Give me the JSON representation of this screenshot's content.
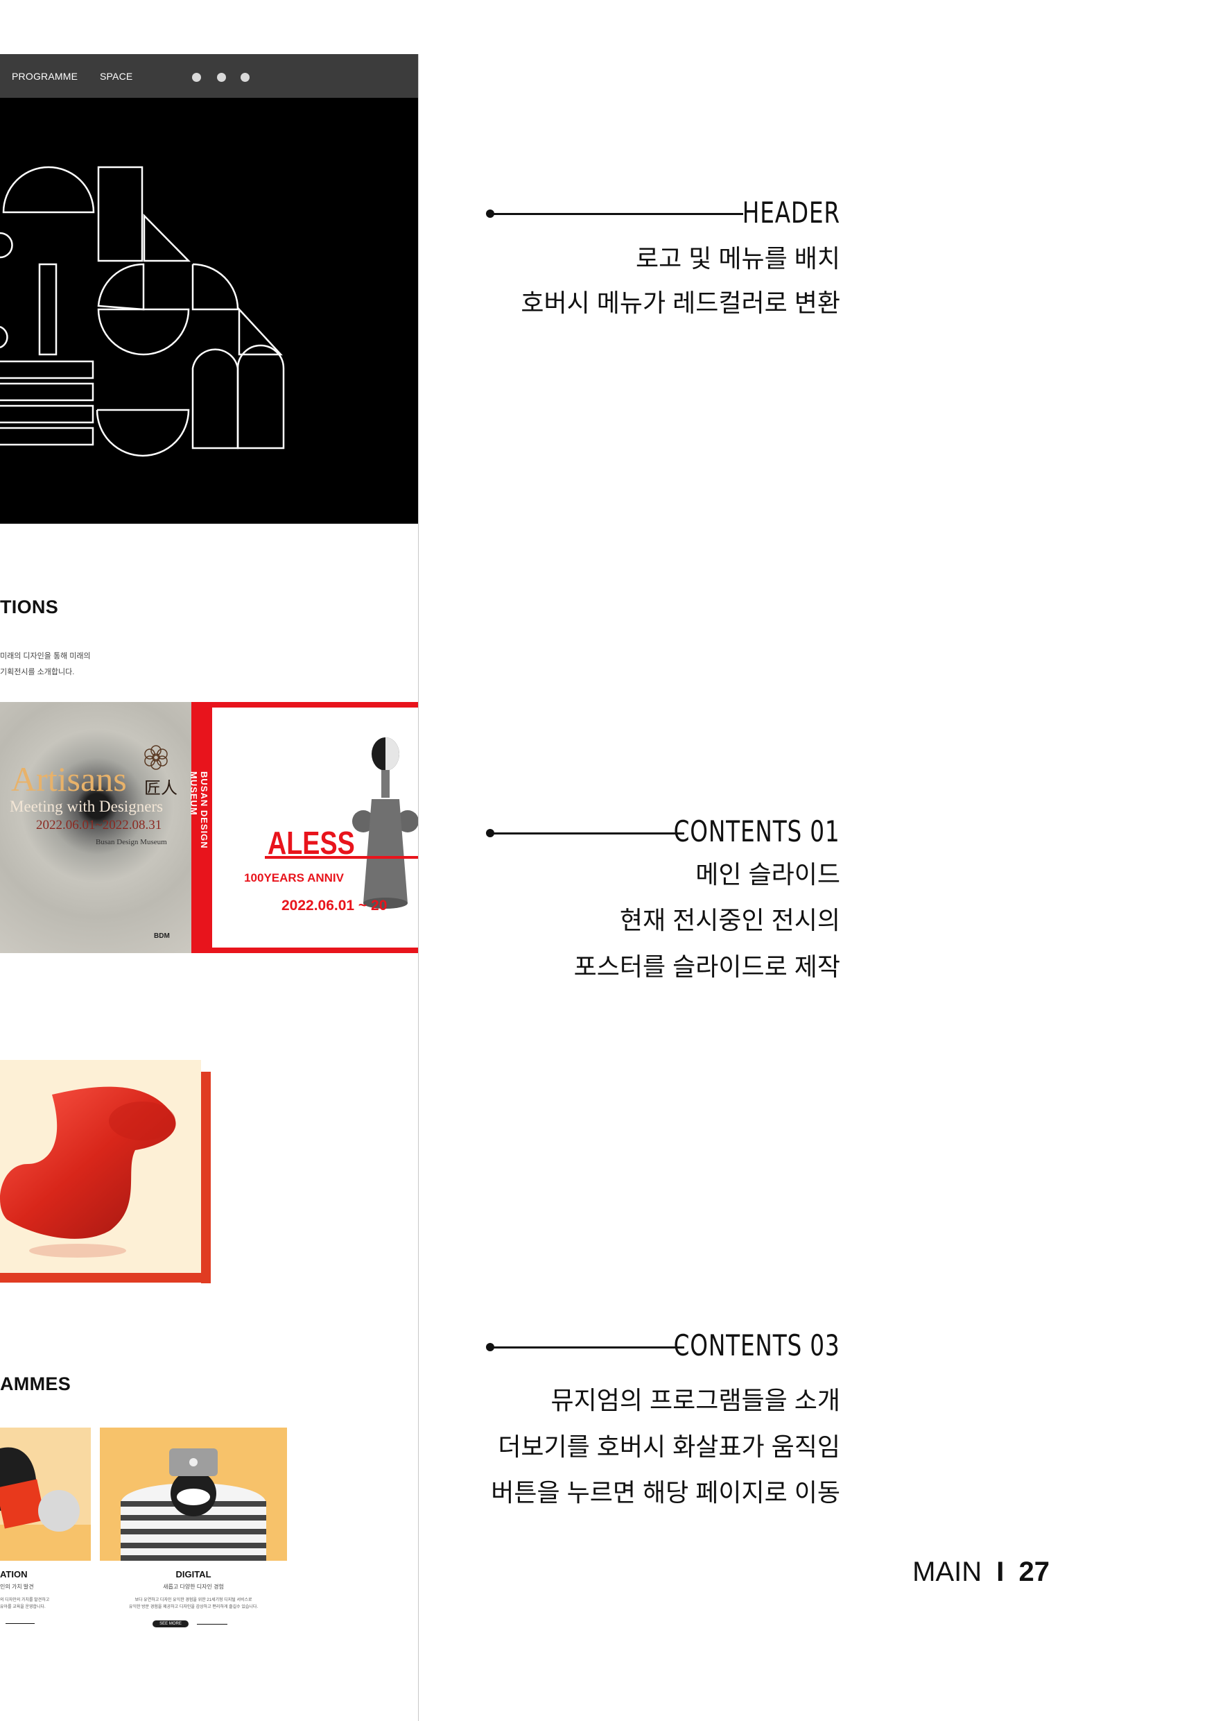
{
  "mockup": {
    "nav": {
      "items": [
        "PROGRAMME",
        "SPACE"
      ],
      "icons": [
        "search-icon",
        "globe-icon",
        "user-icon"
      ]
    },
    "exhibitions": {
      "title_fragment": "TIONS",
      "desc_line1": "미래의 디자인을 통해 미래의",
      "desc_line2": "기획전시를 소개합니다."
    },
    "poster_artisans": {
      "title": "Artisans",
      "hanja": "匠人",
      "subtitle": "Meeting with Designers",
      "dates": "2022.06.01~2022.08.31",
      "venue": "Busan Design Museum",
      "badge": "BDM"
    },
    "poster_alessi": {
      "vertical_text": "BUSAN DESIGN MUSEUM",
      "brand": "ALESS",
      "tagline": "100YEARS ANNIV",
      "dates": "2022.06.01 ~ 20"
    },
    "programmes": {
      "title_fragment": "AMMES",
      "cards": [
        {
          "title": "ATION",
          "line1": "인의 가치 발견",
          "line2": "의 디자인의 가치를 발견하고",
          "line3": "유아를 교육을 운영합니다."
        },
        {
          "title": "DIGITAL",
          "line1": "새롭고 다양한 디자인 경험",
          "line2": "보다 유연하고 디자인 유익한 경험을 위한 21세기형 디지털 서비스로",
          "line3": "유익한 방문 경험을 제공하고 디자인을 감상하고 편리하게 즐길수 있습니다.",
          "button": "SEE MORE"
        }
      ]
    }
  },
  "annotations": [
    {
      "title": "HEADER",
      "lines": [
        "로고 및 메뉴를 배치",
        "호버시 메뉴가 레드컬러로 변환"
      ]
    },
    {
      "title": "CONTENTS 01",
      "lines": [
        "메인 슬라이드",
        "현재 전시중인 전시의",
        "포스터를 슬라이드로 제작"
      ]
    },
    {
      "title": "CONTENTS 03",
      "lines": [
        "뮤지엄의 프로그램들을 소개",
        "더보기를  호버시  화살표가  움직임",
        "버튼을 누르면 해당 페이지로 이동"
      ]
    }
  ],
  "page": {
    "section": "MAIN",
    "separator": "I",
    "number": "27"
  },
  "colors": {
    "accent_red": "#e8141c",
    "nav_bg": "#3c3c3c",
    "hero_bg": "#000000",
    "card_yellow": "#f7c26a"
  }
}
